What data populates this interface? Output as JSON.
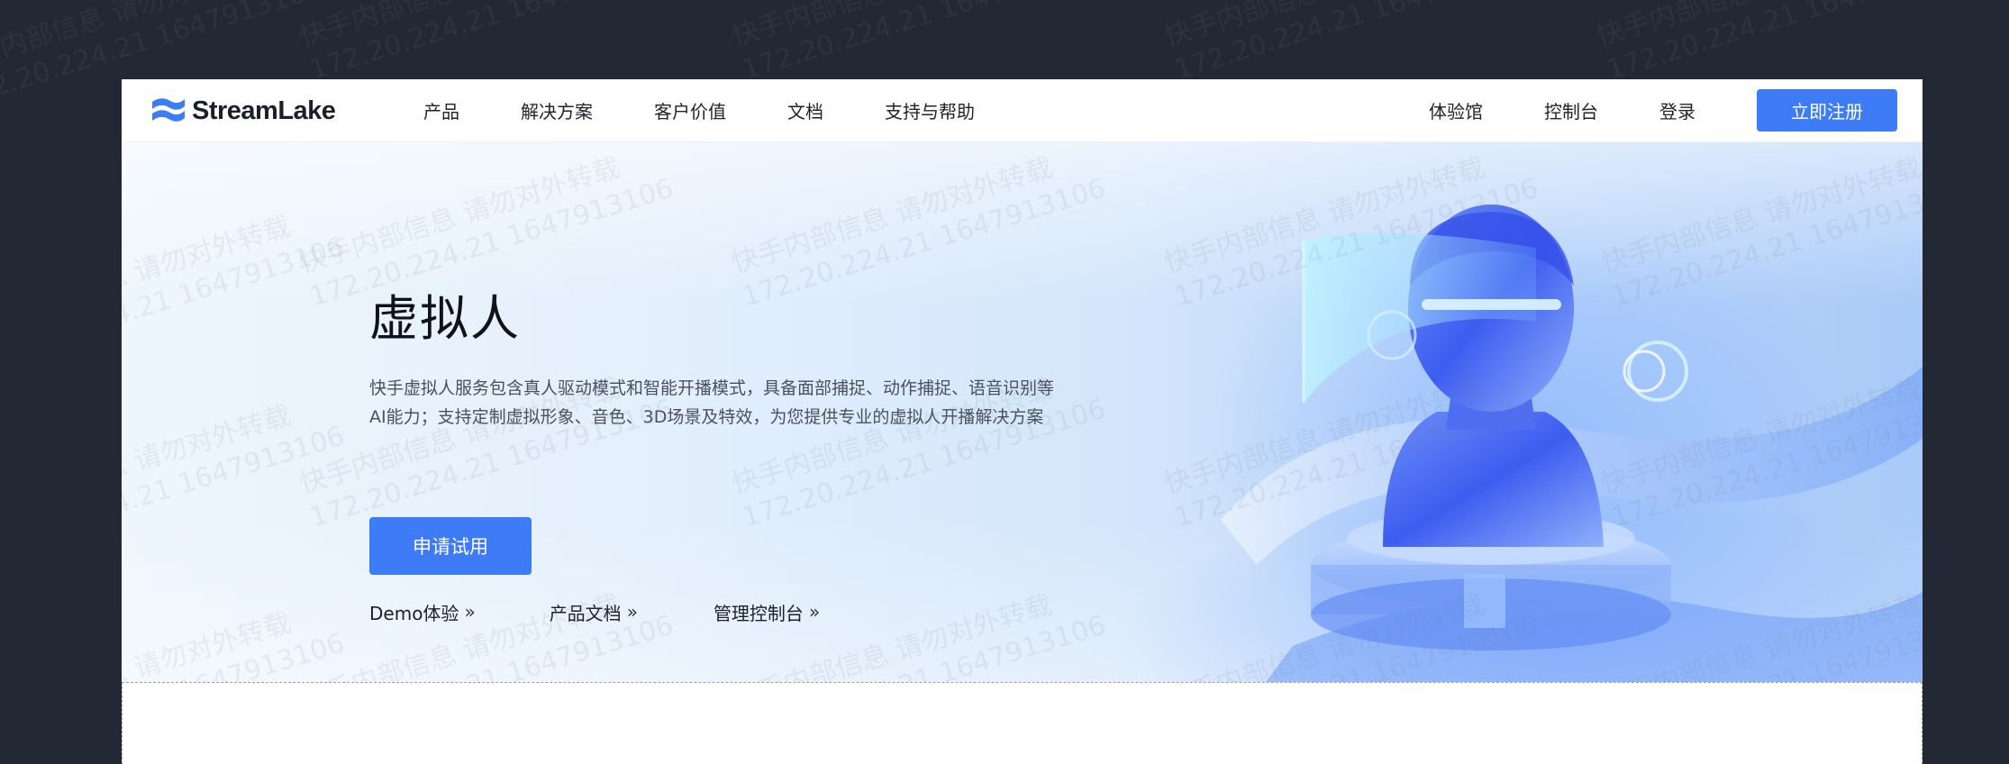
{
  "brand": {
    "name": "StreamLake"
  },
  "nav": {
    "left": [
      "产品",
      "解决方案",
      "客户价值",
      "文档",
      "支持与帮助"
    ],
    "right": [
      "体验馆",
      "控制台",
      "登录"
    ],
    "register_label": "立即注册"
  },
  "hero": {
    "title": "虚拟人",
    "desc_line1": "快手虚拟人服务包含真人驱动模式和智能开播模式，具备面部捕捉、动作捕捉、语音识别等",
    "desc_line2": "AI能力；支持定制虚拟形象、音色、3D场景及特效，为您提供专业的虚拟人开播解决方案",
    "apply_label": "申请试用",
    "links": [
      "Demo体验",
      "产品文档",
      "管理控制台"
    ],
    "link_chevron": "»"
  },
  "watermark": {
    "line1": "快手内部信息 请勿对外转载",
    "line2": "172.20.224.21 1647913106"
  },
  "colors": {
    "accent": "#3d7bf7",
    "page_bg": "#222834",
    "nav_text": "#1f2329"
  },
  "icons": {
    "logo": "streamlake-logo-icon",
    "link_chevron": "double-chevron-right-icon"
  }
}
